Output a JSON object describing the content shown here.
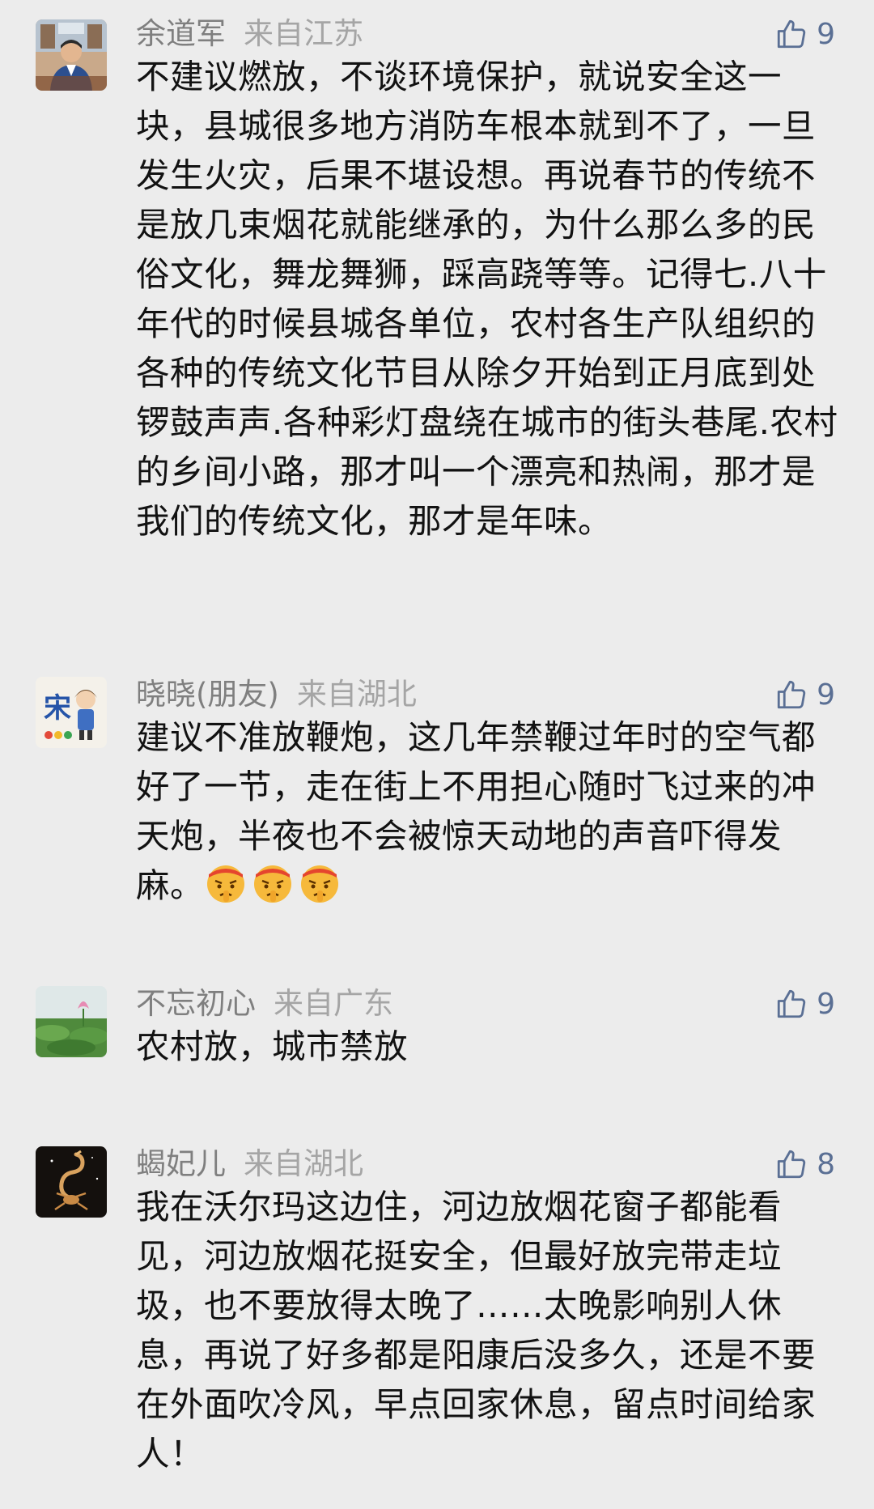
{
  "comments": [
    {
      "name": "余道军",
      "location": "来自江苏",
      "likes": "9",
      "text": "不建议燃放，不谈环境保护，就说安全这一块，县城很多地方消防车根本就到不了，一旦发生火灾，后果不堪设想。再说春节的传统不是放几束烟花就能继承的，为什么那么多的民俗文化，舞龙舞狮，踩高跷等等。记得七.八十年代的时候县城各单位，农村各生产队组织的各种的传统文化节目从除夕开始到正月底到处锣鼓声声.各种彩灯盘绕在城市的街头巷尾.农村的乡间小路，那才叫一个漂亮和热闹，那才是我们的传统文化，那才是年味。"
    },
    {
      "name": "晓晓(朋友)",
      "location": "来自湖北",
      "likes": "9",
      "text": "建议不准放鞭炮，这几年禁鞭过年时的空气都好了一节，走在街上不用担心随时飞过来的冲天炮，半夜也不会被惊天动地的声音吓得发麻。",
      "emojis": [
        "shushing-face-icon",
        "shushing-face-icon",
        "shushing-face-icon"
      ]
    },
    {
      "name": "不忘初心",
      "location": "来自广东",
      "likes": "9",
      "text": "农村放，城市禁放"
    },
    {
      "name": "蝎妃儿",
      "location": "来自湖北",
      "likes": "8",
      "text": "我在沃尔玛这边住，河边放烟花窗子都能看见，河边放烟花挺安全，但最好放完带走垃圾，也不要放得太晚了……太晚影响别人休息，再说了好多都是阳康后没多久，还是不要在外面吹冷风，早点回家休息，留点时间给家人！"
    }
  ],
  "colors": {
    "background": "#ececec",
    "name_text": "#7f7f7f",
    "location_text": "#a5a5a5",
    "like_accent": "#5a6f94",
    "body_text": "#121212"
  },
  "icons": {
    "like": "thumbs-up-icon"
  }
}
